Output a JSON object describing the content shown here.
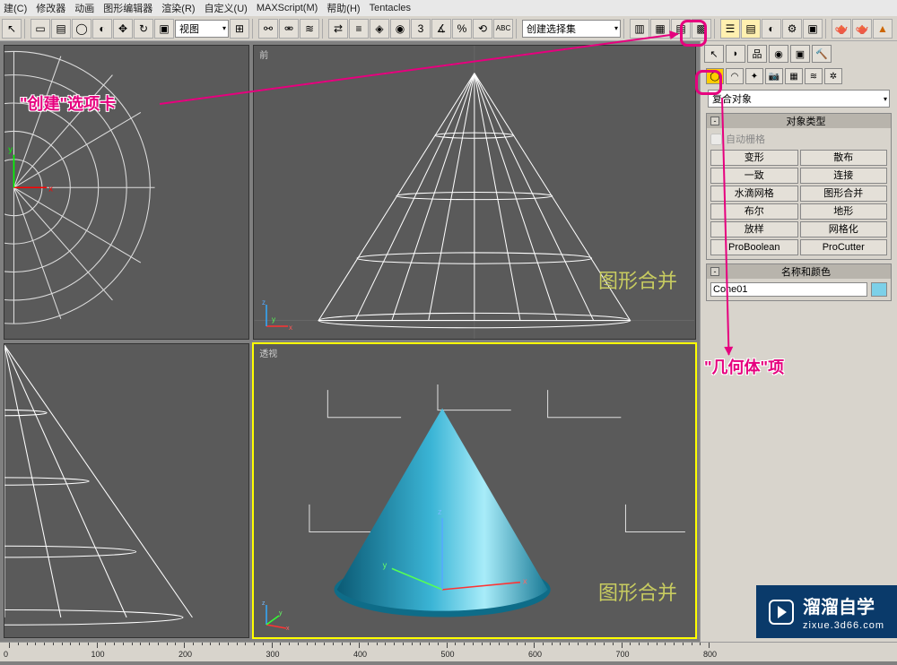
{
  "menu": [
    "建(C)",
    "修改器",
    "动画",
    "图形编辑器",
    "渲染(R)",
    "自定义(U)",
    "MAXScript(M)",
    "帮助(H)",
    "Tentacles"
  ],
  "toolbar2": {
    "view_dd": "视图",
    "selset_dd": "创建选择集"
  },
  "viewports": {
    "top": "",
    "front": "前",
    "persp": "透视",
    "watermark": "图形合并"
  },
  "panel": {
    "category": "复合对象",
    "rollout1": "对象类型",
    "autogrid": "自动栅格",
    "buttons": [
      "变形",
      "散布",
      "一致",
      "连接",
      "水滴网格",
      "图形合并",
      "布尔",
      "地形",
      "放样",
      "网格化",
      "ProBoolean",
      "ProCutter"
    ],
    "rollout2": "名称和颜色",
    "obj_name": "Cone01",
    "swatch_color": "#7cd0e8"
  },
  "annotations": {
    "create_tab": "\"创建\"选项卡",
    "geom_item": "\"几何体\"项"
  },
  "ruler": [
    "0",
    "100",
    "200",
    "300",
    "400",
    "500",
    "600",
    "700",
    "800"
  ],
  "branding": {
    "title": "溜溜自学",
    "url": "zixue.3d66.com"
  }
}
